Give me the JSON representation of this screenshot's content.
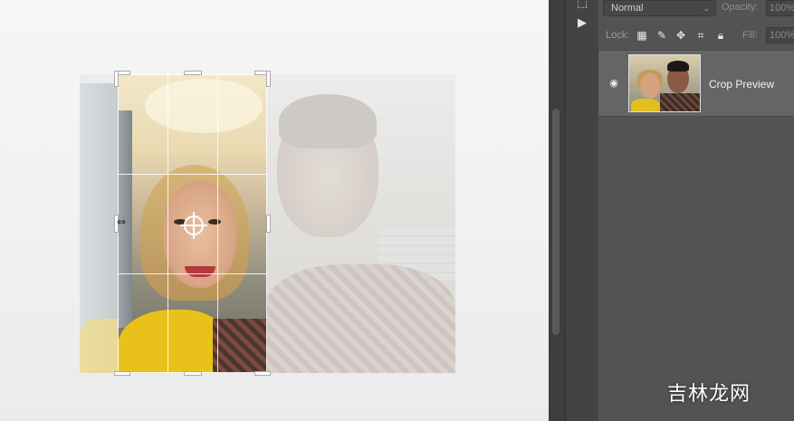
{
  "layers_panel": {
    "blend_mode": "Normal",
    "opacity_label": "Opacity:",
    "opacity_value": "100%",
    "lock_label": "Lock:",
    "fill_label": "Fill:",
    "fill_value": "100%",
    "layers": [
      {
        "name": "Crop Preview",
        "visible": true
      }
    ]
  },
  "canvas": {
    "tool": "crop",
    "grid": "rule-of-thirds"
  },
  "watermark": "吉林龙网",
  "icons": {
    "eye": "eye-icon",
    "lock_transparent": "lock-transparent-pixels-icon",
    "lock_paint": "brush-icon",
    "lock_position": "move-icon",
    "lock_artboard": "artboard-icon",
    "lock_all": "lock-icon",
    "play": "play-icon"
  }
}
